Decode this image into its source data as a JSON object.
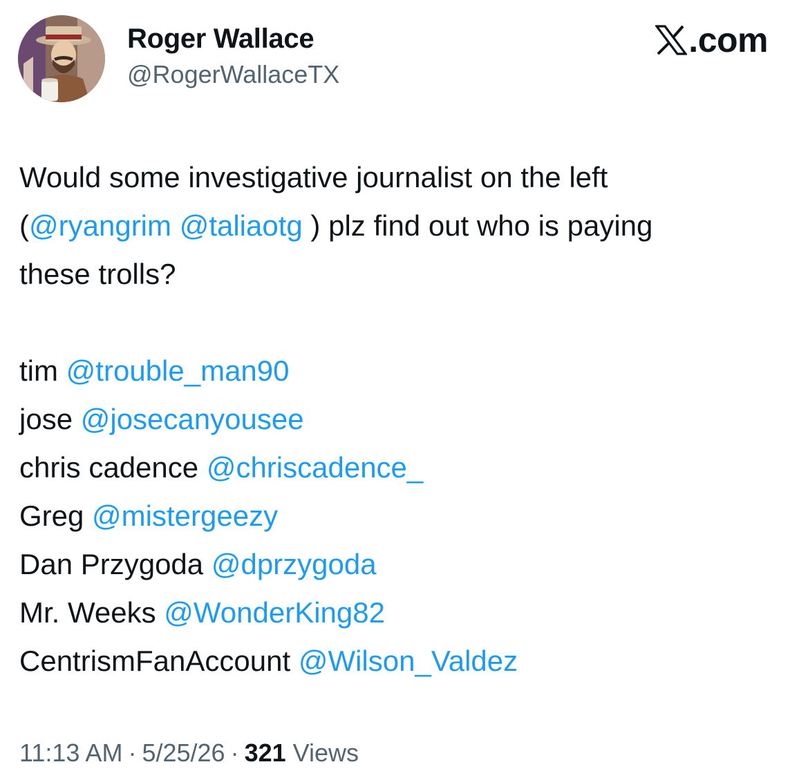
{
  "author": {
    "display_name": "Roger Wallace",
    "handle": "@RogerWallaceTX",
    "avatar_icon": "cartoon-avatar-icon"
  },
  "brand": {
    "logo_icon": "x-logo-icon",
    "label": ".com"
  },
  "tweet": {
    "intro_line1": "Would some investigative journalist on the left",
    "intro_open_paren": "(",
    "mention_1": "@ryangrim",
    "mention_2": "@taliaotg",
    "intro_line2_rest": " ) plz find out who is paying",
    "intro_line3": "these trolls?",
    "accounts": [
      {
        "name": "tim",
        "handle": "@trouble_man90"
      },
      {
        "name": "jose",
        "handle": "@josecanyousee"
      },
      {
        "name": "chris cadence",
        "handle": "@chriscadence_"
      },
      {
        "name": "Greg",
        "handle": "@mistergeezy"
      },
      {
        "name": "Dan Przygoda",
        "handle": "@dprzygoda"
      },
      {
        "name": "Mr. Weeks",
        "handle": "@WonderKing82"
      },
      {
        "name": "CentrismFanAccount",
        "handle": "@Wilson_Valdez"
      }
    ]
  },
  "meta": {
    "time": "11:13 AM",
    "date": "5/25/26",
    "views_count": "321",
    "views_label": "Views",
    "separator": "·"
  },
  "colors": {
    "text": "#0f1419",
    "secondary": "#536471",
    "link": "#1d9bf0",
    "background": "#ffffff"
  }
}
